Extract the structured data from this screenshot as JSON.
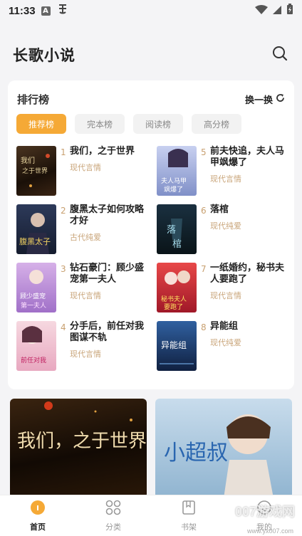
{
  "status_bar": {
    "time": "11:33"
  },
  "header": {
    "title": "长歌小说"
  },
  "ranking": {
    "title": "排行榜",
    "refresh_label": "换一换",
    "tabs": [
      {
        "label": "推荐榜",
        "active": true
      },
      {
        "label": "完本榜",
        "active": false
      },
      {
        "label": "阅读榜",
        "active": false
      },
      {
        "label": "高分榜",
        "active": false
      }
    ],
    "books": [
      {
        "rank": "1",
        "title": "我们，之于世界",
        "genre": "现代言情"
      },
      {
        "rank": "2",
        "title": "腹黑太子如何攻略才好",
        "genre": "古代纯爱"
      },
      {
        "rank": "3",
        "title": "钻石豪门：顾少盛宠第一夫人",
        "genre": "现代言情"
      },
      {
        "rank": "4",
        "title": "分手后，前任对我图谋不轨",
        "genre": "现代言情"
      },
      {
        "rank": "5",
        "title": "前夫快追，夫人马甲飒爆了",
        "genre": "现代言情"
      },
      {
        "rank": "6",
        "title": "落棺",
        "genre": "现代纯爱"
      },
      {
        "rank": "7",
        "title": "一纸婚约，秘书夫人要跑了",
        "genre": "现代言情"
      },
      {
        "rank": "8",
        "title": "异能组",
        "genre": "现代纯爱"
      }
    ]
  },
  "banners": [
    {
      "cover_text": "我们，之于世界"
    },
    {
      "cover_text": "小超叔"
    }
  ],
  "nav": [
    {
      "label": "首页",
      "active": true
    },
    {
      "label": "分类",
      "active": false
    },
    {
      "label": "书架",
      "active": false
    },
    {
      "label": "我的",
      "active": false
    }
  ],
  "watermark": {
    "text": "007游戏网",
    "url": "www.yx007.com"
  },
  "colors": {
    "accent": "#f5a936",
    "genre": "#c9a57a",
    "rank": "#c8a070"
  }
}
